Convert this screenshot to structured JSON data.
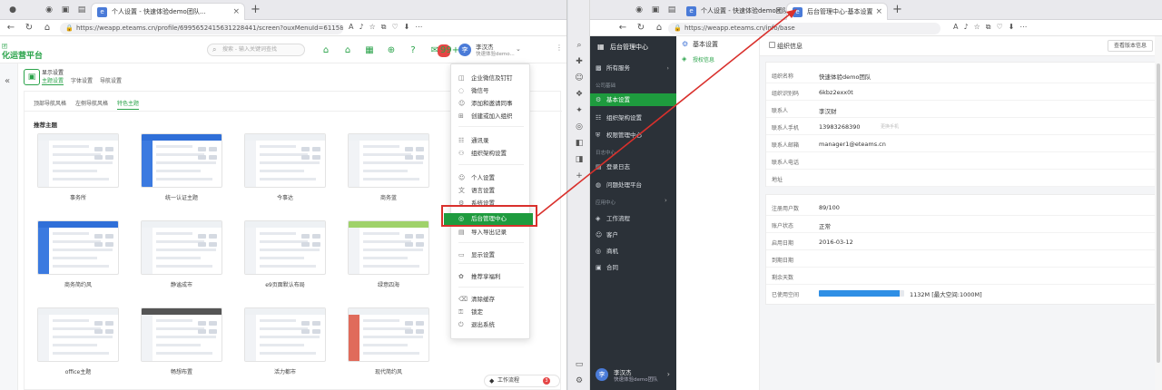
{
  "left_window": {
    "tabs": [
      {
        "label": "个人设置 - 快速体验demo团队...",
        "active": true
      }
    ],
    "url": "https://weapp.eteams.cn/profile/6995652415631228441/screen?ouxMenuId=6115882664419316...",
    "header": {
      "logo_sub": "团",
      "logo_title": "化运营平台",
      "search_placeholder": "搜索 - 输入关键词查找",
      "badge": "99+",
      "user_name": "李汉杰",
      "user_org": "快速体验demo..."
    },
    "breadcrumb": {
      "title": "显示设置",
      "subtabs": [
        "主题设置",
        "字体设置",
        "导航设置"
      ]
    },
    "content_tabs": [
      "顶部导航风格",
      "左侧导航风格",
      "特色主题"
    ],
    "section_title": "推荐主题",
    "themes": [
      "事务所",
      "统一认证主题",
      "今事达",
      "商务蓝",
      "商务简约风",
      "静谧成市",
      "e9页面默认布局",
      "绿意四海",
      "office主题",
      "畅想布置",
      "活力都市",
      "现代简约风"
    ],
    "workflow_button": "工作流程",
    "workflow_badge": "3"
  },
  "menu": {
    "items": [
      {
        "icon": "enterprise-icon",
        "label": "企业微信及钉钉"
      },
      {
        "icon": "wechat-icon",
        "label": "微信号"
      },
      {
        "icon": "team-icon",
        "label": "添加和邀请同事"
      },
      {
        "icon": "org-icon",
        "label": "创建或加入组织"
      },
      {
        "icon": "contacts-icon",
        "label": "通讯录"
      },
      {
        "icon": "org-chart-icon",
        "label": "组织架构设置"
      },
      {
        "icon": "person-icon",
        "label": "个人设置"
      },
      {
        "icon": "language-icon",
        "label": "语言设置"
      },
      {
        "icon": "gear-icon",
        "label": "系统设置"
      },
      {
        "icon": "admin-icon",
        "label": "后台管理中心"
      },
      {
        "icon": "log-icon",
        "label": "导入导出记录"
      },
      {
        "icon": "display-icon",
        "label": "显示设置"
      },
      {
        "icon": "gift-icon",
        "label": "推荐享福利"
      },
      {
        "icon": "clear-icon",
        "label": "清除缓存"
      },
      {
        "icon": "lock-icon",
        "label": "锁定"
      },
      {
        "icon": "logout-icon",
        "label": "退出系统"
      }
    ],
    "highlighted": "后台管理中心"
  },
  "right_window": {
    "tabs": [
      {
        "label": "个人设置 - 快速体验demo团队",
        "active": false
      },
      {
        "label": "后台管理中心-基本设置",
        "active": true
      }
    ],
    "url": "https://weapp.eteams.cn/info/base",
    "sidebar": {
      "title": "后台管理中心",
      "all_services": "所有服务",
      "group_company": "公司基础",
      "items_company": [
        "基本设置",
        "组织架构设置",
        "权限管理中心"
      ],
      "group_system": "日志中心",
      "items_system": [
        "登录日志",
        "问题处理平台"
      ],
      "group_apps": "应用中心",
      "items_apps": [
        "工作流程",
        "客户",
        "商机",
        "合同"
      ],
      "user_name": "李汉杰",
      "user_org": "快速体验demo团队"
    },
    "subnav": {
      "header": "基本设置",
      "item": "授权信息"
    },
    "main": {
      "title": "组织信息",
      "top_button": "查看版本信息",
      "fields": [
        {
          "label": "组织名称",
          "value": "快速体验demo团队"
        },
        {
          "label": "组织识别码",
          "value": "6kbz2exx0t"
        },
        {
          "label": "联系人",
          "value": "李汉财"
        },
        {
          "label": "联系人手机",
          "value": "13983268390",
          "hint": "更换手机"
        },
        {
          "label": "联系人邮箱",
          "value": "manager1@eteams.cn"
        },
        {
          "label": "联系人电话",
          "value": ""
        },
        {
          "label": "地址",
          "value": ""
        }
      ],
      "license_fields": [
        {
          "label": "注册用户数",
          "value": "89/100"
        },
        {
          "label": "账户状态",
          "value": "正常"
        },
        {
          "label": "启用日期",
          "value": "2016-03-12"
        },
        {
          "label": "到期日期",
          "value": ""
        },
        {
          "label": "剩余天数",
          "value": ""
        }
      ],
      "storage_label": "已使用空间",
      "storage_text": "1132M [最大空间:1000M]",
      "storage_fraction": 0.95
    }
  },
  "colors": {
    "brand_green": "#1e9b3e",
    "annotation_red": "#d9302c",
    "sidebar_dark": "#2b3138"
  }
}
